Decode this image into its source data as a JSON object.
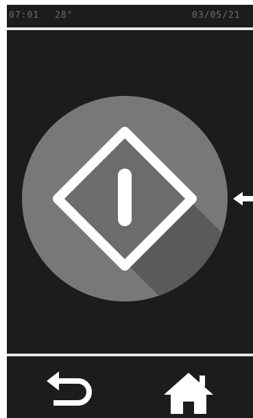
{
  "status": {
    "time": "07:01",
    "temperature": "28°",
    "date": "03/05/21"
  },
  "main": {
    "power_button_icon": "power-diamond-icon",
    "next_arrow_icon": "chevron-left-icon"
  },
  "nav": {
    "back_icon": "back-arrow-icon",
    "home_icon": "home-icon"
  },
  "colors": {
    "background": "#1c1c1c",
    "dial": "#787878",
    "dial_shadow": "#5a5a5a",
    "icon": "#ffffff",
    "divider": "#e8e8e8",
    "status_text": "#6e6e6e"
  }
}
